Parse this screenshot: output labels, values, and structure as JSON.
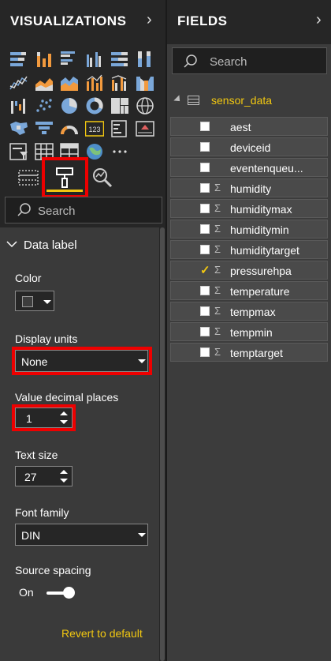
{
  "visualizations": {
    "title": "VISUALIZATIONS",
    "search_placeholder": "Search",
    "section_title": "Data label",
    "color_label": "Color",
    "display_units_label": "Display units",
    "display_units_value": "None",
    "decimal_label": "Value decimal places",
    "decimal_value": "1",
    "text_size_label": "Text size",
    "text_size_value": "27",
    "font_family_label": "Font family",
    "font_family_value": "DIN",
    "source_spacing_label": "Source spacing",
    "toggle_state": "On",
    "revert_label": "Revert to default",
    "more_icon_label": "…"
  },
  "fields": {
    "title": "FIELDS",
    "search_placeholder": "Search",
    "table_name": "sensor_data",
    "items": [
      {
        "name": "aest",
        "sigma": false,
        "checked": false
      },
      {
        "name": "deviceid",
        "sigma": false,
        "checked": false
      },
      {
        "name": "eventenqueu...",
        "sigma": false,
        "checked": false
      },
      {
        "name": "humidity",
        "sigma": true,
        "checked": false
      },
      {
        "name": "humiditymax",
        "sigma": true,
        "checked": false
      },
      {
        "name": "humiditymin",
        "sigma": true,
        "checked": false
      },
      {
        "name": "humiditytarget",
        "sigma": true,
        "checked": false
      },
      {
        "name": "pressurehpa",
        "sigma": true,
        "checked": true
      },
      {
        "name": "temperature",
        "sigma": true,
        "checked": false
      },
      {
        "name": "tempmax",
        "sigma": true,
        "checked": false
      },
      {
        "name": "tempmin",
        "sigma": true,
        "checked": false
      },
      {
        "name": "temptarget",
        "sigma": true,
        "checked": false
      }
    ]
  },
  "colors": {
    "accent": "#f2c811",
    "highlight": "#e00000",
    "pane_dark": "#262626",
    "format_bg": "#3a3a3a"
  }
}
